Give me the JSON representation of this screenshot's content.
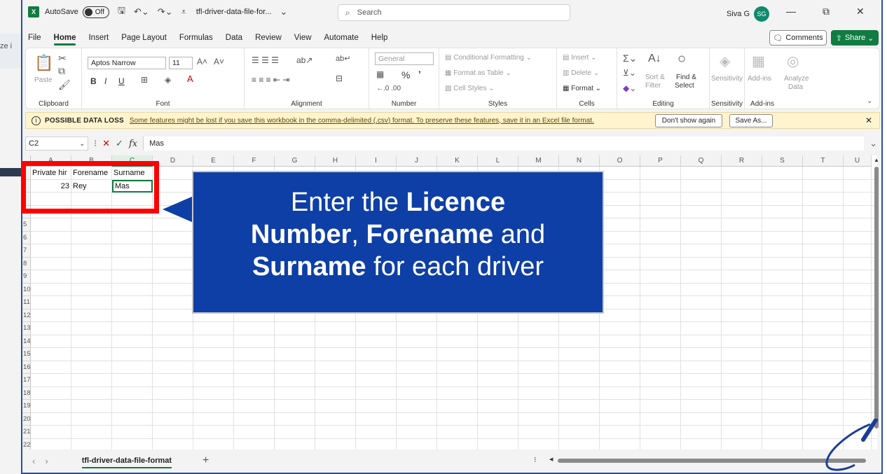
{
  "titlebar": {
    "app_icon": "X",
    "autosave_label": "AutoSave",
    "autosave_state": "Off",
    "file_name": "tfl-driver-data-file-for...",
    "search_placeholder": "Search",
    "user_name": "Siva G",
    "user_initials": "SG",
    "icons": [
      "save-icon",
      "undo-icon",
      "redo-icon",
      "customize-icon",
      "minimize-icon",
      "restore-icon",
      "close-icon"
    ]
  },
  "menu": {
    "tabs": [
      "File",
      "Home",
      "Insert",
      "Page Layout",
      "Formulas",
      "Data",
      "Review",
      "View",
      "Automate",
      "Help"
    ],
    "active": "Home",
    "comments_label": "Comments",
    "share_label": "Share"
  },
  "ribbon": {
    "clipboard": {
      "label": "Clipboard",
      "paste": "Paste"
    },
    "font": {
      "label": "Font",
      "font_name": "Aptos Narrow",
      "font_size": "11",
      "bold": "B",
      "italic": "I",
      "underline": "U"
    },
    "alignment": {
      "label": "Alignment"
    },
    "number": {
      "label": "Number",
      "format": "General",
      "percent": "%"
    },
    "styles": {
      "label": "Styles",
      "conditional": "Conditional Formatting",
      "format_table": "Format as Table",
      "cell_styles": "Cell Styles"
    },
    "cells": {
      "label": "Cells",
      "insert": "Insert",
      "delete": "Delete",
      "format": "Format"
    },
    "editing": {
      "label": "Editing",
      "sort_filter_1": "Sort &",
      "sort_filter_2": "Filter",
      "find_select_1": "Find &",
      "find_select_2": "Select"
    },
    "sensitivity": {
      "label": "Sensitivity",
      "button": "Sensitivity"
    },
    "addins": {
      "label": "Add-ins",
      "button": "Add-ins",
      "analyze_1": "Analyze",
      "analyze_2": "Data"
    }
  },
  "infobar": {
    "title": "POSSIBLE DATA LOSS",
    "message": "Some features might be lost if you save this workbook in the comma-delimited (.csv) format. To preserve these features, save it in an Excel file format.",
    "dont_show": "Don't show again",
    "save_as": "Save As..."
  },
  "formula_bar": {
    "name_box": "C2",
    "fx": "fx",
    "value": "Mas"
  },
  "grid": {
    "columns": [
      "A",
      "B",
      "C",
      "D",
      "E",
      "F",
      "G",
      "H",
      "I",
      "J",
      "K",
      "L",
      "M",
      "N",
      "O",
      "P",
      "Q",
      "R",
      "S",
      "T",
      "U"
    ],
    "rows": [
      "",
      "",
      "",
      "",
      "5",
      "6",
      "7",
      "8",
      "9",
      "10",
      "11",
      "12",
      "13",
      "14",
      "15",
      "16",
      "17",
      "18",
      "19",
      "20",
      "21",
      "22"
    ],
    "cells": {
      "a1": "Private hir",
      "b1": "Forename",
      "c1": "Surname",
      "a2": "23",
      "b2": "Rey",
      "c2": "Mas"
    },
    "selected_cell": "C2"
  },
  "sheet_tabs": {
    "active": "tfl-driver-data-file-format",
    "add": "+"
  },
  "annotation": {
    "line1_pre": "Enter the ",
    "line1_bold": "Licence",
    "line2_bold1": "Number",
    "line2_mid": ", ",
    "line2_bold2": "Forename",
    "line2_post": " and",
    "line3_bold": "Surname",
    "line3_post": " for each driver"
  },
  "colors": {
    "excel_green": "#107c41",
    "callout_blue": "#0e3fa6",
    "highlight_red": "#ff0000",
    "infobar_yellow": "#fff4ce"
  }
}
